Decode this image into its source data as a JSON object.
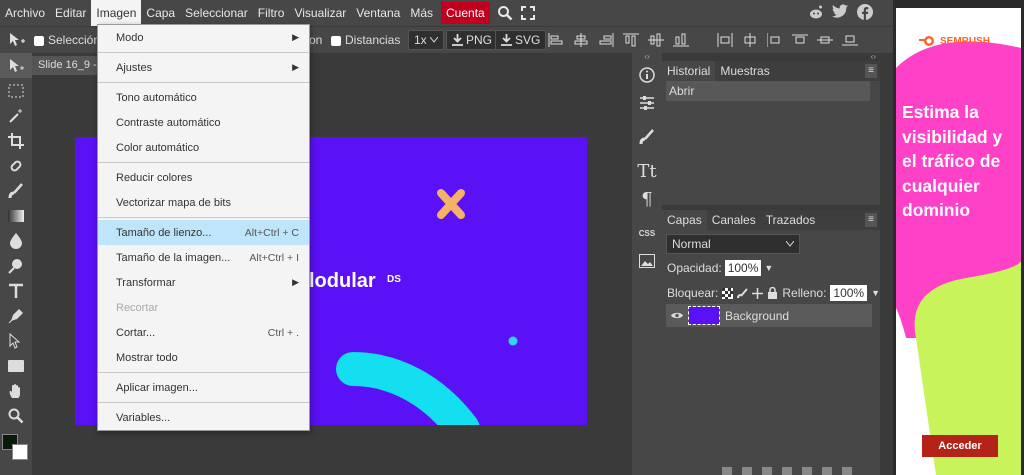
{
  "menubar": {
    "items": [
      "Archivo",
      "Editar",
      "Imagen",
      "Capa",
      "Seleccionar",
      "Filtro",
      "Visualizar",
      "Ventana",
      "Más"
    ],
    "cuenta": "Cuenta"
  },
  "options": {
    "seleccion": "Selección",
    "distancias": "Distancias",
    "zoom": "1x",
    "png": "PNG",
    "svg": "SVG",
    "on_partial": "on"
  },
  "doc": {
    "tab": "Slide 16_9 -",
    "canvas_text": "lodular",
    "canvas_sup": "DS"
  },
  "menu": {
    "modo": "Modo",
    "ajustes": "Ajustes",
    "tono": "Tono automático",
    "contraste": "Contraste automático",
    "color": "Color automático",
    "reducir": "Reducir colores",
    "vectorizar": "Vectorizar mapa de bits",
    "tamano_lienzo": "Tamaño de lienzo...",
    "tamano_lienzo_sc": "Alt+Ctrl + C",
    "tamano_imagen": "Tamaño de la imagen...",
    "tamano_imagen_sc": "Alt+Ctrl + I",
    "transformar": "Transformar",
    "recortar": "Recortar",
    "cortar": "Cortar...",
    "cortar_sc": "Ctrl + .",
    "mostrar": "Mostrar todo",
    "aplicar": "Aplicar imagen...",
    "variables": "Variables..."
  },
  "history": {
    "tabs": [
      "Historial",
      "Muestras"
    ],
    "items": [
      "Abrir"
    ]
  },
  "layers": {
    "tabs": [
      "Capas",
      "Canales",
      "Trazados"
    ],
    "blend": "Normal",
    "opacity_label": "Opacidad:",
    "opacity": "100%",
    "lock_label": "Bloquear:",
    "fill_label": "Relleno:",
    "fill": "100%",
    "items": [
      {
        "name": "Background"
      }
    ]
  },
  "ad": {
    "brand": "SEMRUSH",
    "headline": "Estima la visibilidad y el tráfico de cualquier dominio",
    "cta": "Acceder"
  }
}
